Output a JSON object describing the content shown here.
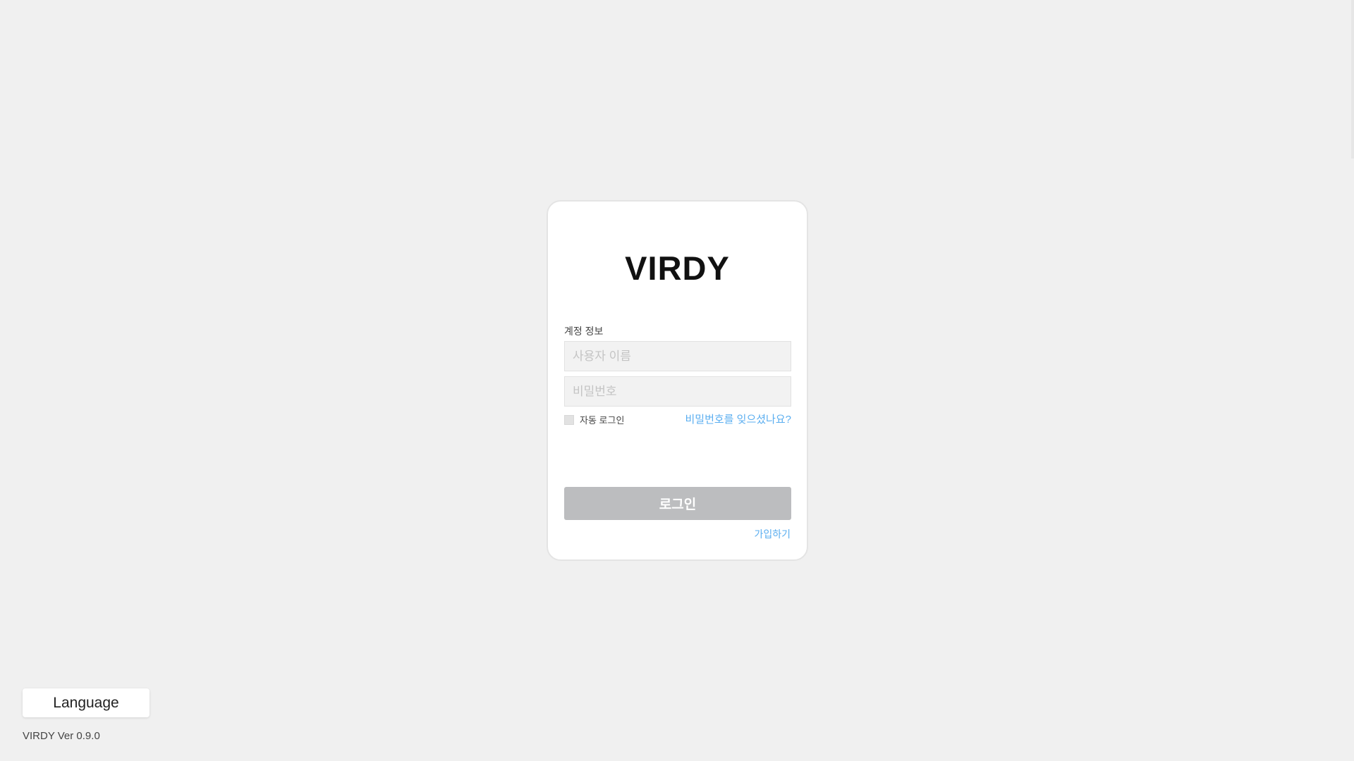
{
  "login_card": {
    "logo_text": "VIRDY",
    "section_label": "계정 정보",
    "username_placeholder": "사용자 이름",
    "password_placeholder": "비밀번호",
    "auto_login_label": "자동 로그인",
    "auto_login_checked": false,
    "forgot_password_link": "비밀번호를 잊으셨나요?",
    "login_button_label": "로그인",
    "signup_link": "가입하기"
  },
  "footer": {
    "language_button_label": "Language",
    "version_text": "VIRDY Ver 0.9.0"
  },
  "colors": {
    "background": "#f0f0f0",
    "card": "#ffffff",
    "link": "#5aaef0",
    "button_disabled": "#bcbdbf"
  }
}
